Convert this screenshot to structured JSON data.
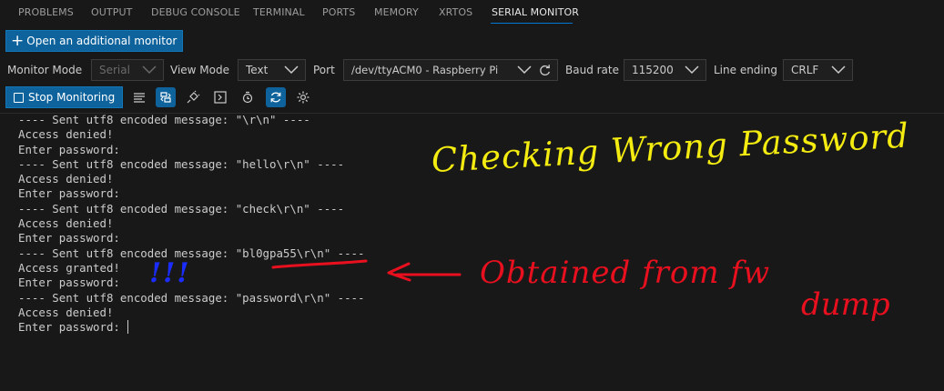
{
  "panel_tabs": [
    "PROBLEMS",
    "OUTPUT",
    "DEBUG CONSOLE",
    "TERMINAL",
    "PORTS",
    "MEMORY",
    "XRTOS",
    "SERIAL MONITOR"
  ],
  "active_tab": "SERIAL MONITOR",
  "add_monitor_label": "Open an additional monitor",
  "settings": {
    "monitor_mode_label": "Monitor Mode",
    "monitor_mode_value": "Serial",
    "view_mode_label": "View Mode",
    "view_mode_value": "Text",
    "port_label": "Port",
    "port_value": "/dev/ttyACM0 - Raspberry Pi",
    "baud_rate_label": "Baud rate",
    "baud_rate_value": "115200",
    "line_ending_label": "Line ending",
    "line_ending_value": "CRLF"
  },
  "stop_button_label": "Stop Monitoring",
  "toolbar_icons": [
    "clear-output-icon",
    "toggle-terminal-icon",
    "plug-icon",
    "terminal-icon",
    "timestamp-icon",
    "auto-scroll-icon",
    "gear-icon"
  ],
  "console_lines": [
    "---- Sent utf8 encoded message: \"\\r\\n\" ----",
    "Access denied!",
    "Enter password:",
    "---- Sent utf8 encoded message: \"hello\\r\\n\" ----",
    "Access denied!",
    "Enter password:",
    "---- Sent utf8 encoded message: \"check\\r\\n\" ----",
    "Access denied!",
    "Enter password:",
    "---- Sent utf8 encoded message: \"bl0gpa55\\r\\n\" ----",
    "Access granted!",
    "Enter password:",
    "---- Sent utf8 encoded message: \"password\\r\\n\" ----",
    "Access denied!",
    "Enter password: "
  ],
  "annotations": {
    "yellow": "Checking Wrong Password",
    "red_line1": "Obtained from fw",
    "red_line2": "dump",
    "blue": "!!!"
  },
  "colors": {
    "accent": "#0e639c",
    "annotation_yellow": "#f4ec10",
    "annotation_red": "#e8101e",
    "annotation_blue": "#1a2cff"
  }
}
